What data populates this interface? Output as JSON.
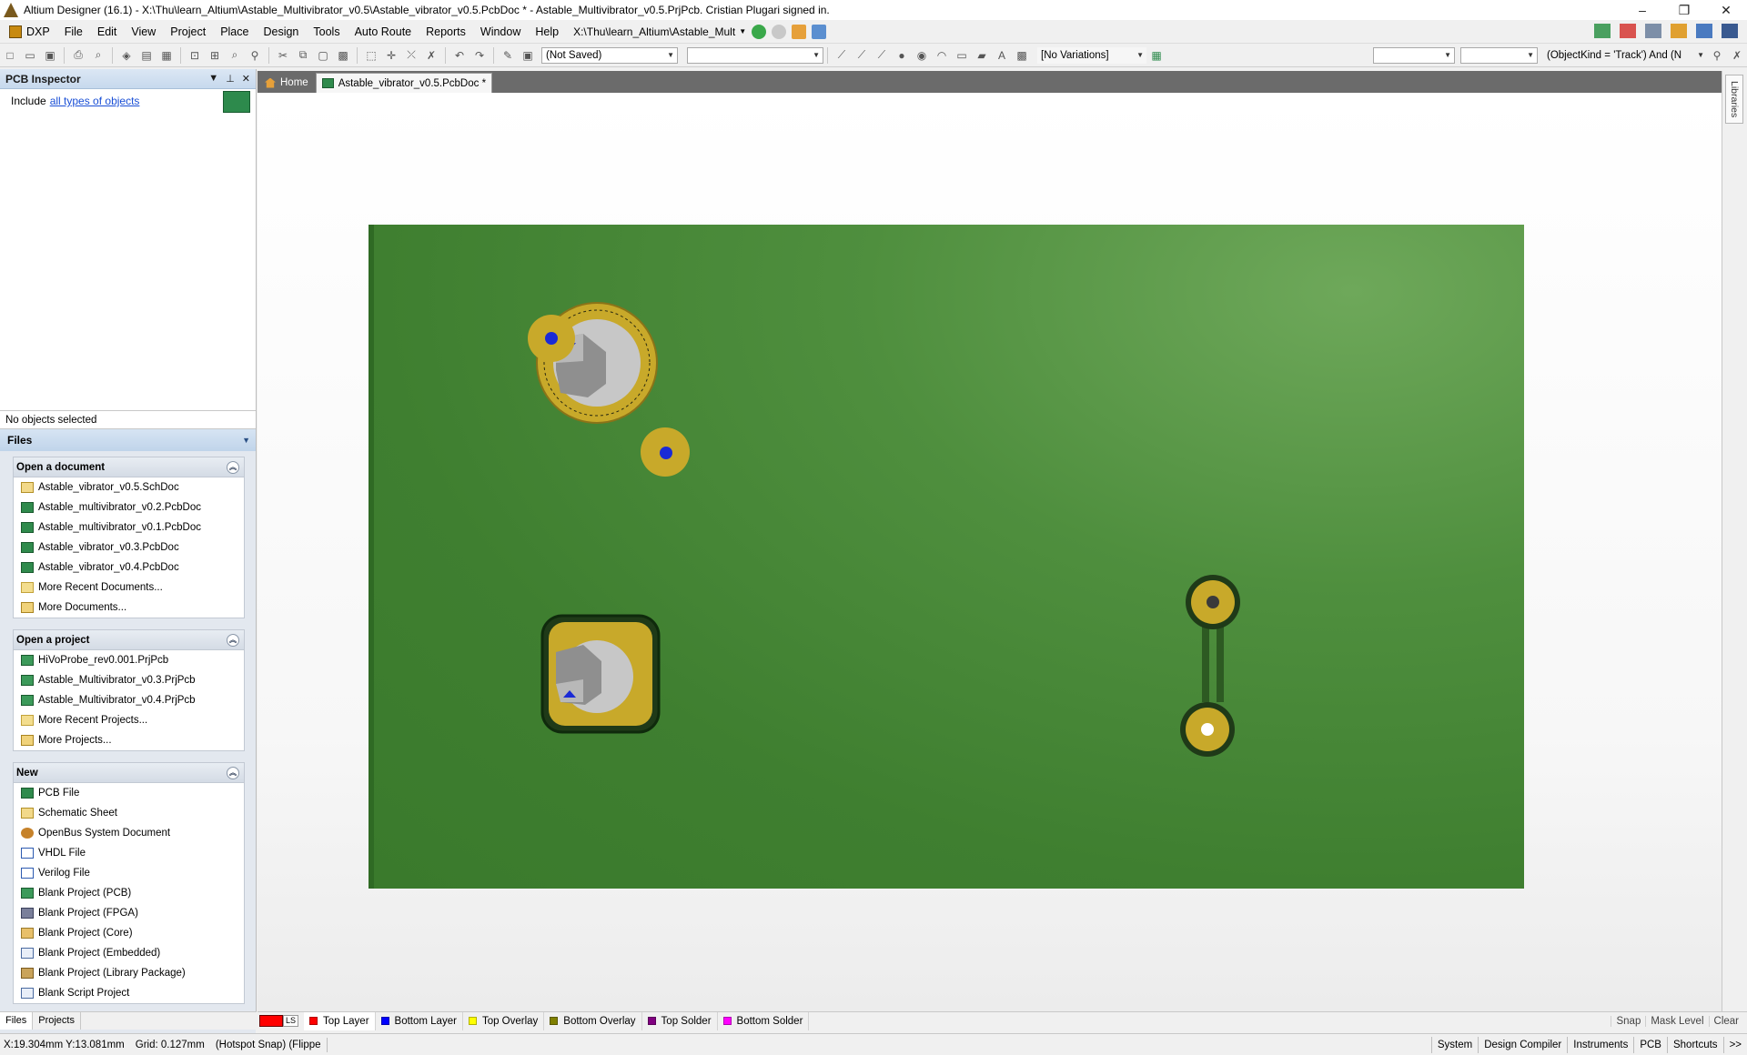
{
  "window": {
    "title": "Altium Designer (16.1) - X:\\Thu\\learn_Altium\\Astable_Multivibrator_v0.5\\Astable_vibrator_v0.5.PcbDoc * - Astable_Multivibrator_v0.5.PrjPcb. Cristian Plugari signed in.",
    "minimize": "–",
    "restore": "❐",
    "close": "✕"
  },
  "menu": {
    "dxp": "DXP",
    "items": [
      "File",
      "Edit",
      "View",
      "Project",
      "Place",
      "Design",
      "Tools",
      "Auto Route",
      "Reports",
      "Window",
      "Help"
    ],
    "path": "X:\\Thu\\learn_Altium\\Astable_Mult"
  },
  "toolbar": {
    "saved_combo": "(Not Saved)",
    "empty_combo": "",
    "variations_combo": "[No Variations]",
    "filter_combo_a": "",
    "filter_combo_b": "",
    "query_combo": "(ObjectKind = 'Track') And (N"
  },
  "inspector": {
    "title": "PCB Inspector",
    "include_label": "Include",
    "include_link": "all types of objects",
    "no_objects": "No objects selected"
  },
  "files_panel": {
    "title": "Files",
    "sections": [
      {
        "title": "Open a document",
        "items": [
          {
            "label": "Astable_vibrator_v0.5.SchDoc",
            "icon": "schdoc-icon"
          },
          {
            "label": "Astable_multivibrator_v0.2.PcbDoc",
            "icon": "pcbdoc-icon"
          },
          {
            "label": "Astable_multivibrator_v0.1.PcbDoc",
            "icon": "pcbdoc-icon"
          },
          {
            "label": "Astable_vibrator_v0.3.PcbDoc",
            "icon": "pcbdoc-icon"
          },
          {
            "label": "Astable_vibrator_v0.4.PcbDoc",
            "icon": "pcbdoc-icon"
          },
          {
            "label": "More Recent Documents...",
            "icon": "folder-icon"
          },
          {
            "label": "More Documents...",
            "icon": "open-folder-icon"
          }
        ]
      },
      {
        "title": "Open a project",
        "items": [
          {
            "label": "HiVoProbe_rev0.001.PrjPcb",
            "icon": "prjpcb-icon"
          },
          {
            "label": "Astable_Multivibrator_v0.3.PrjPcb",
            "icon": "prjpcb-icon"
          },
          {
            "label": "Astable_Multivibrator_v0.4.PrjPcb",
            "icon": "prjpcb-icon"
          },
          {
            "label": "More Recent Projects...",
            "icon": "folder-icon"
          },
          {
            "label": "More Projects...",
            "icon": "open-folder-icon"
          }
        ]
      },
      {
        "title": "New",
        "items": [
          {
            "label": "PCB File",
            "icon": "pcbdoc-icon"
          },
          {
            "label": "Schematic Sheet",
            "icon": "schdoc-icon"
          },
          {
            "label": "OpenBus System Document",
            "icon": "openbus-icon"
          },
          {
            "label": "VHDL File",
            "icon": "vhdl-icon"
          },
          {
            "label": "Verilog File",
            "icon": "verilog-icon"
          },
          {
            "label": "Blank Project (PCB)",
            "icon": "prjpcb-icon"
          },
          {
            "label": "Blank Project (FPGA)",
            "icon": "fpga-icon"
          },
          {
            "label": "Blank Project (Core)",
            "icon": "core-icon"
          },
          {
            "label": "Blank Project (Embedded)",
            "icon": "embedded-icon"
          },
          {
            "label": "Blank Project (Library Package)",
            "icon": "library-icon"
          },
          {
            "label": "Blank Script Project",
            "icon": "script-icon"
          }
        ]
      }
    ],
    "bottom_tabs": [
      "Files",
      "Projects"
    ]
  },
  "doc_tabs": {
    "home": "Home",
    "active": "Astable_vibrator_v0.5.PcbDoc *"
  },
  "right_strip": {
    "libraries": "Libraries"
  },
  "layers": {
    "ls": "LS",
    "items": [
      {
        "label": "Top Layer",
        "color": "#ff0000",
        "active": true
      },
      {
        "label": "Bottom Layer",
        "color": "#0000ff",
        "active": false
      },
      {
        "label": "Top Overlay",
        "color": "#ffff00",
        "active": false
      },
      {
        "label": "Bottom Overlay",
        "color": "#808000",
        "active": false
      },
      {
        "label": "Top Solder",
        "color": "#800080",
        "active": false
      },
      {
        "label": "Bottom Solder",
        "color": "#ff00ff",
        "active": false
      }
    ],
    "right": [
      "Snap",
      "Mask Level",
      "Clear"
    ]
  },
  "status": {
    "coords": "X:19.304mm Y:13.081mm",
    "grid": "Grid: 0.127mm",
    "snap": "(Hotspot Snap) (Flippe",
    "buttons": [
      "System",
      "Design Compiler",
      "Instruments",
      "PCB",
      "Shortcuts",
      ">>"
    ]
  },
  "board": {
    "color": "#4f8f3e",
    "pad_color": "#c8a92a",
    "via_hole_color": "#1a2ad6"
  }
}
